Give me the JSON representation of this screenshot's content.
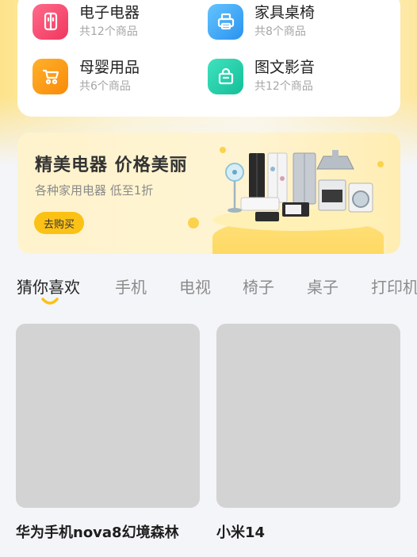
{
  "categories": [
    {
      "name": "电子电器",
      "count": "共12个商品",
      "icon": "fridge-icon",
      "color": "#f5496f"
    },
    {
      "name": "家具桌椅",
      "count": "共8个商品",
      "icon": "printer-icon",
      "color": "#3aa7f5"
    },
    {
      "name": "母婴用品",
      "count": "共6个商品",
      "icon": "stroller-icon",
      "color": "#fb9a16"
    },
    {
      "name": "图文影音",
      "count": "共12个商品",
      "icon": "bag-icon",
      "color": "#22cfaa"
    }
  ],
  "banner": {
    "title": "精美电器 价格美丽",
    "subtitle": "各种家用电器 低至1折",
    "button": "去购买",
    "image": "home-appliances-illustration"
  },
  "tabs": [
    {
      "label": "猜你喜欢",
      "active": true
    },
    {
      "label": "手机",
      "active": false
    },
    {
      "label": "电视",
      "active": false
    },
    {
      "label": "椅子",
      "active": false
    },
    {
      "label": "桌子",
      "active": false
    },
    {
      "label": "打印机",
      "active": false
    }
  ],
  "products": [
    {
      "name": "华为手机nova8幻境森林"
    },
    {
      "name": "小米14"
    }
  ],
  "colors": {
    "accent": "#fbc115",
    "background": "#f4f5f9",
    "placeholder": "#d3d3d3"
  }
}
